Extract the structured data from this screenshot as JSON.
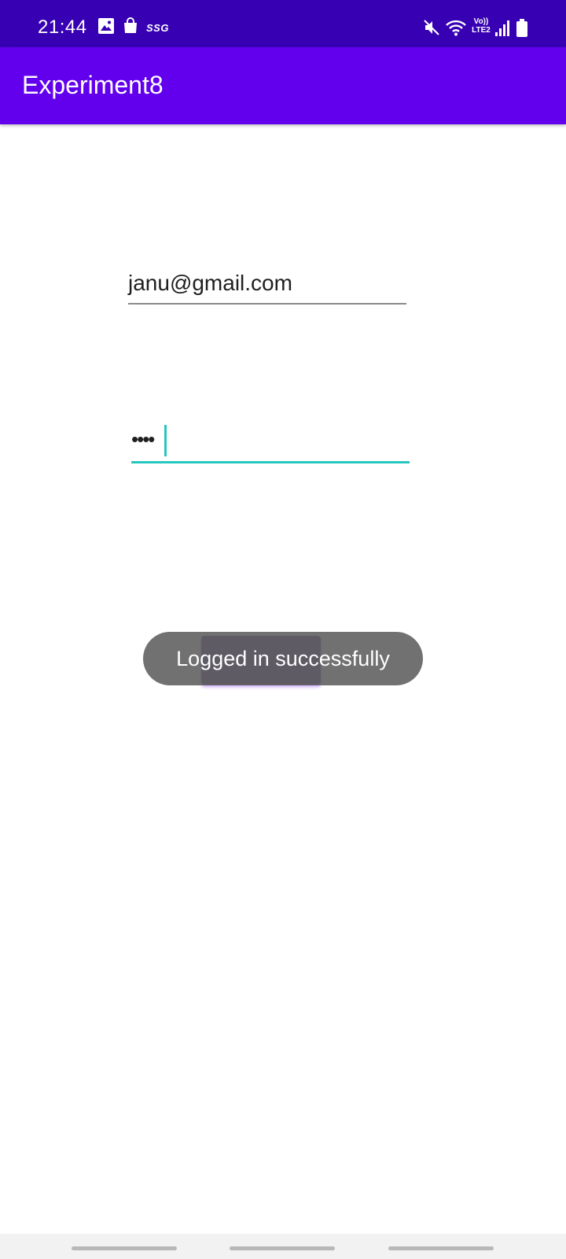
{
  "status_bar": {
    "time": "21:44",
    "icons": [
      "gallery-icon",
      "shopping-bag-icon",
      "mute-icon",
      "wifi-icon",
      "signal-icon",
      "battery-icon"
    ],
    "carrier_badge": "SSG",
    "volte_line1": "Vo))",
    "volte_line2": "LTE2",
    "background_color": "#3700b3"
  },
  "app_bar": {
    "title": "Experiment8",
    "background_color": "#6200ee"
  },
  "form": {
    "email_value": "janu@gmail.com",
    "password_value": "••••",
    "focus_color": "#26c6c0"
  },
  "toast": {
    "message": "Logged in successfully"
  },
  "nav_bar": {
    "background_color": "#f2f2f2"
  }
}
